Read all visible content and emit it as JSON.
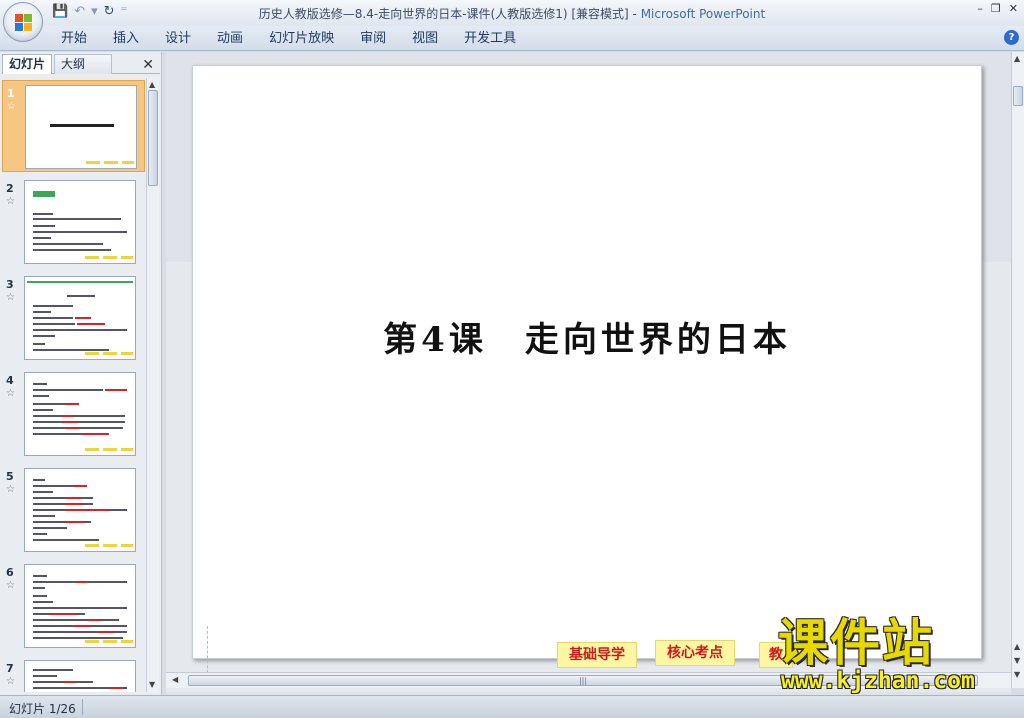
{
  "window": {
    "title": "历史人教版选修—8.4-走向世界的日本-课件(人教版选修1) [兼容模式] - ",
    "app_name": "Microsoft PowerPoint"
  },
  "ribbon": {
    "tabs": [
      "开始",
      "插入",
      "设计",
      "动画",
      "幻灯片放映",
      "审阅",
      "视图",
      "开发工具"
    ]
  },
  "left_panel": {
    "tab_slides": "幻灯片",
    "tab_outline": "大纲",
    "close": "✕",
    "thumbnails": [
      {
        "num": "1"
      },
      {
        "num": "2"
      },
      {
        "num": "3"
      },
      {
        "num": "4"
      },
      {
        "num": "5"
      },
      {
        "num": "6"
      },
      {
        "num": "7"
      }
    ]
  },
  "slide": {
    "title": "第4课　走向世界的日本",
    "buttons": [
      "基础导学",
      "核心考点",
      "教"
    ]
  },
  "status_bar": {
    "slide_count": "幻灯片 1/26"
  },
  "watermark": {
    "text": "课件站",
    "url": "www.kjzhan.com"
  }
}
